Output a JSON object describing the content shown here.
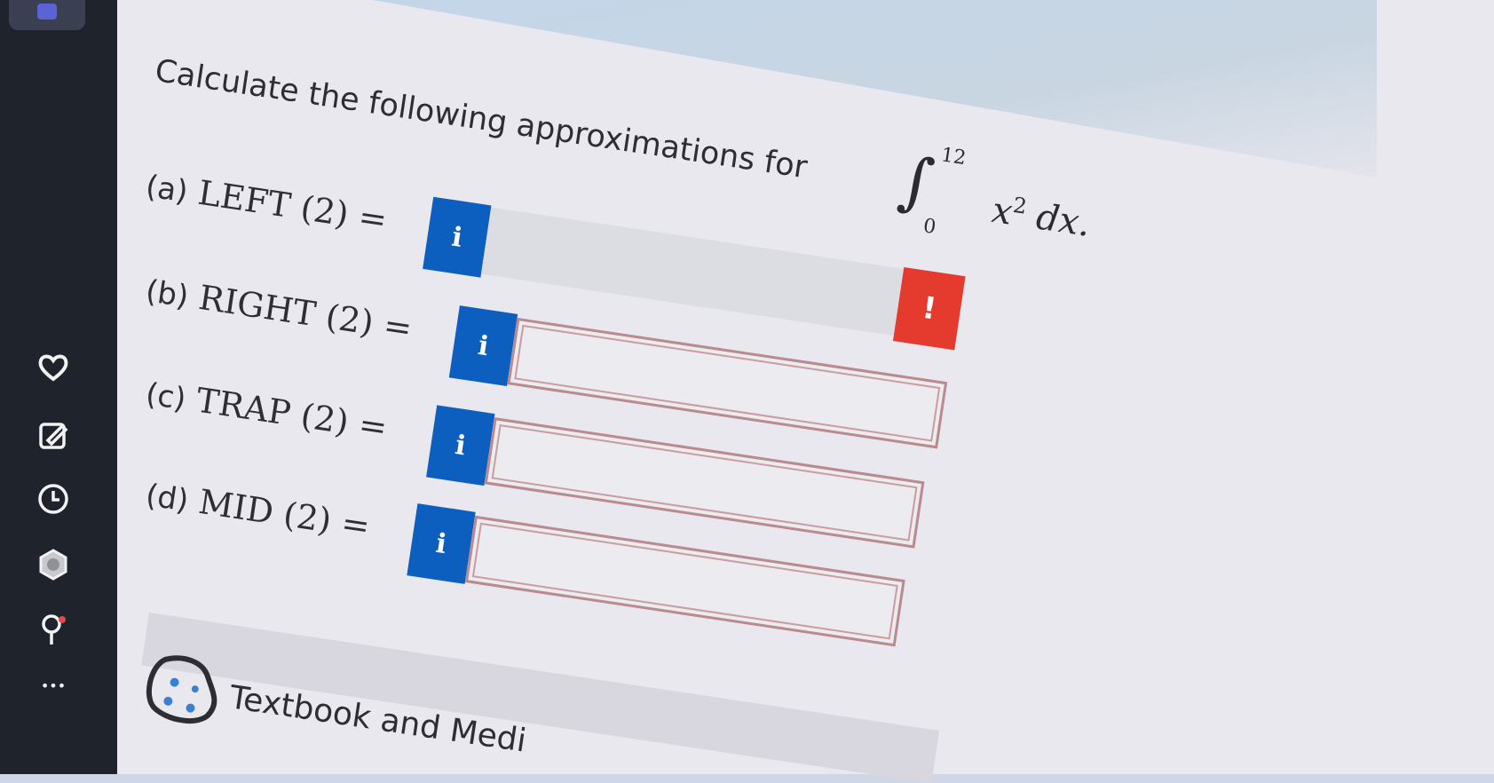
{
  "sidebar": {
    "icons": [
      "heart-icon",
      "edit-icon",
      "clock-icon",
      "hexagon-icon",
      "pin-icon",
      "more-icon"
    ],
    "more_label": "•••"
  },
  "question": {
    "prompt": "Calculate the following approximations for",
    "integral": {
      "lower": "0",
      "upper": "12",
      "integrand": "x",
      "exponent": "2",
      "differential": "dx."
    }
  },
  "parts": [
    {
      "letter": "(a)",
      "name": "LEFT (2) =",
      "info": "i",
      "value": "",
      "error": "!"
    },
    {
      "letter": "(b)",
      "name": "RIGHT (2) =",
      "info": "i",
      "value": ""
    },
    {
      "letter": "(c)",
      "name": "TRAP (2) =",
      "info": "i",
      "value": ""
    },
    {
      "letter": "(d)",
      "name": "MID (2) =",
      "info": "i",
      "value": ""
    }
  ],
  "footer": {
    "textbook_label": "Textbook and Medi"
  },
  "colors": {
    "info_blue": "#0d5fbf",
    "error_red": "#e53a2e",
    "field_border": "#b98a8e"
  }
}
